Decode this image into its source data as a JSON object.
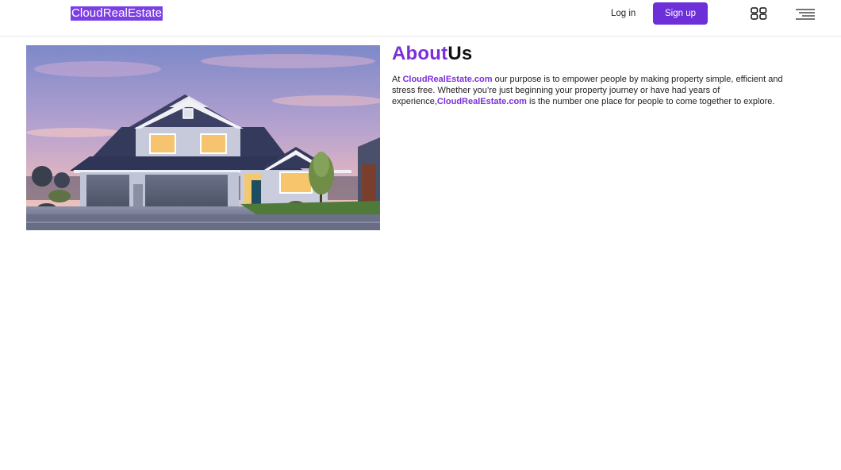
{
  "header": {
    "logo": "CloudRealEstate",
    "login_label": "Log in",
    "signup_label": "Sign up",
    "grid_icon": "grid-icon",
    "menu_icon": "hamburger-menu-icon"
  },
  "hero": {
    "image_subject": "house-photo"
  },
  "about": {
    "title_accent": "About",
    "title_rest": "Us",
    "text_1": "At ",
    "brand_1": "CloudRealEstate.com",
    "text_2": " our purpose is to empower people by making property simple, efficient and stress free. Whether you’re just beginning your property journey or have had years of experience,",
    "brand_2": "CloudRealEstate.com",
    "text_3": " is the number one place for people to come together to explore."
  },
  "colors": {
    "accent": "#7b2fd9",
    "button": "#6c2fd8",
    "logo_bg": "#7b3fe4"
  }
}
